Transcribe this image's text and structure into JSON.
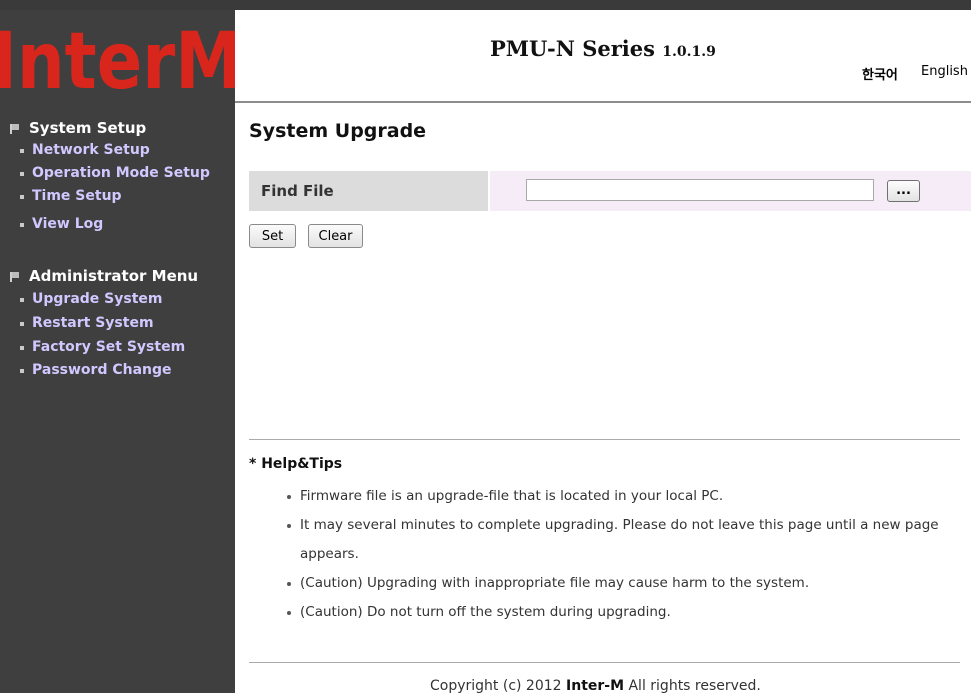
{
  "logo": {
    "text": "InterM"
  },
  "header": {
    "title": "PMU-N Series",
    "version": "1.0.1.9",
    "lang_korean": "한국어",
    "lang_english": "English"
  },
  "sidebar": {
    "sections": [
      {
        "header": "System Setup",
        "items": [
          "Network Setup",
          "Operation Mode Setup",
          "Time Setup",
          "View Log"
        ]
      },
      {
        "header": "Administrator Menu",
        "items": [
          "Upgrade System",
          "Restart System",
          "Factory Set System",
          "Password Change"
        ]
      }
    ]
  },
  "main": {
    "page_title": "System Upgrade",
    "find_file_label": "Find File",
    "file_value": "",
    "browse_label": "...",
    "set_label": "Set",
    "clear_label": "Clear"
  },
  "help": {
    "title": "* Help&Tips",
    "tips": [
      "Firmware file is an upgrade-file that is located in your local PC.",
      "It may several minutes to complete upgrading. Please do not leave this page until a new page appears.",
      "(Caution) Upgrading with inappropriate file may cause harm to the system.",
      "(Caution) Do not turn off the system during upgrading."
    ]
  },
  "footer": {
    "prefix": "Copyright (c) 2012 ",
    "brand": "Inter-M",
    "suffix": " All rights reserved."
  },
  "colors": {
    "sidebar_bg": "#3f3f3f",
    "menu_item": "#d0c8ff",
    "logo_red": "#d9261c",
    "find_label_bg": "#dcdcdc",
    "find_input_bg": "#f5ecf8"
  }
}
